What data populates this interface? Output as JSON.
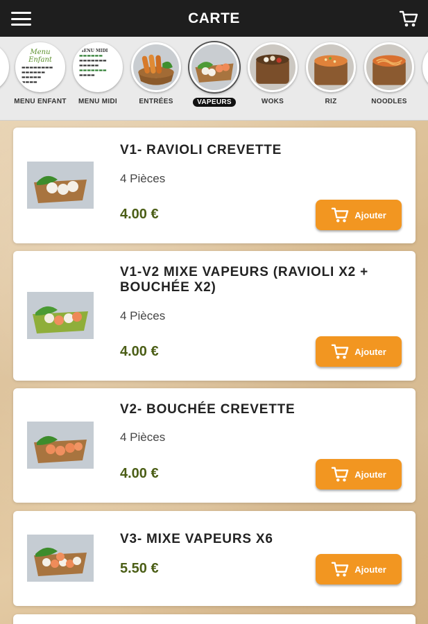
{
  "header": {
    "title": "CARTE"
  },
  "categories": [
    {
      "label": "MENU ENFANT",
      "kind": "menu-enfant",
      "menu_title": "Menu Enfant"
    },
    {
      "label": "MENU MIDI",
      "kind": "menu-midi",
      "menu_title": "MENU MIDI"
    },
    {
      "label": "ENTRÉES",
      "kind": "food"
    },
    {
      "label": "VAPEURS",
      "kind": "food",
      "active": true
    },
    {
      "label": "WOKS",
      "kind": "food"
    },
    {
      "label": "RIZ",
      "kind": "food"
    },
    {
      "label": "NOODLES",
      "kind": "food"
    }
  ],
  "products": [
    {
      "name": "V1- RAVIOLI CREVETTE",
      "desc": "4 Pièces",
      "price": "4.00 €",
      "button": "Ajouter"
    },
    {
      "name": "V1-V2 MIXE VAPEURS (RAVIOLI X2 + BOUCHÉE X2)",
      "desc": "4 Pièces",
      "price": "4.00 €",
      "button": "Ajouter"
    },
    {
      "name": "V2- BOUCHÉE CREVETTE",
      "desc": "4 Pièces",
      "price": "4.00 €",
      "button": "Ajouter"
    },
    {
      "name": "V3- MIXE VAPEURS X6",
      "desc": "",
      "price": "5.50 €",
      "button": "Ajouter"
    }
  ],
  "colors": {
    "topbar": "#1e1e1e",
    "accent": "#f29621",
    "price": "#4b5e16"
  },
  "icons": {
    "menu": "hamburger-icon",
    "cart": "cart-icon"
  }
}
